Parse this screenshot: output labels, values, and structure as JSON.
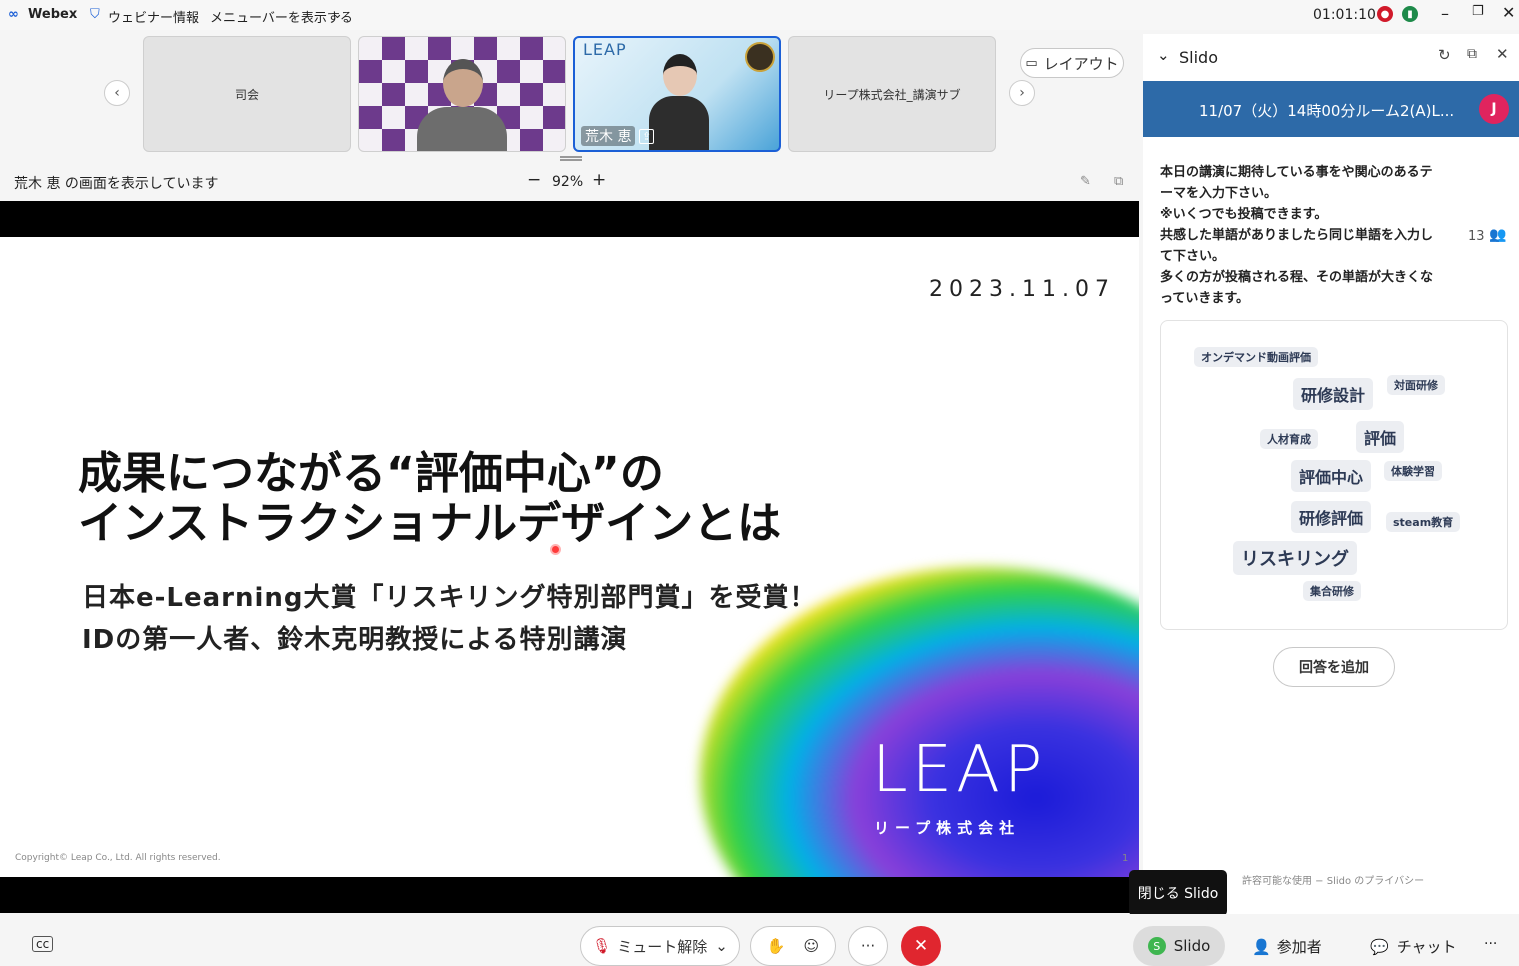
{
  "menubar": {
    "app_name": "Webex",
    "webinar_info": "ウェビナー情報",
    "show_menu": "メニューバーを表示する",
    "timer": "01:01:10"
  },
  "thumbnails": {
    "host_label": "司会",
    "speaker_name": "荒木 恵",
    "sub_label": "リープ株式会社_講演サブ",
    "layout_button": "レイアウト",
    "speaker_logo_text": "LEAP"
  },
  "share_bar": {
    "status": "荒木 恵 の画面を表示しています",
    "zoom": "92%",
    "zoom_out": "−",
    "zoom_in": "+"
  },
  "slide": {
    "date": "2023.11.07",
    "title_line1": "成果につながる“評価中心”の",
    "title_line2": "インストラクショナルデザインとは",
    "sub_line1": "日本e-Learning大賞「リスキリング特別部門賞」を受賞！",
    "sub_line2": "IDの第一人者、鈴木克明教授による特別講演",
    "logo": "LEAP",
    "company": "リープ株式会社",
    "copyright": "Copyright© Leap Co., Ltd. All rights reserved.",
    "page": "1"
  },
  "slido": {
    "title": "Slido",
    "room": "11/07（火）14時00分ルーム2(A)L...",
    "avatar": "J",
    "question_lines": [
      "本日の講演に期待している事をや関心のあるテ",
      "ーマを入力下さい。",
      "※いくつでも投稿できます。",
      "共感した単語がありましたら同じ単語を入力し",
      "て下さい。",
      "多くの方が投稿される程、その単語が大きくな",
      "っていきます。"
    ],
    "participants": "13",
    "words": [
      "オンデマンド動画評価",
      "研修設計",
      "対面研修",
      "人材育成",
      "評価",
      "評価中心",
      "体験学習",
      "研修評価",
      "steam教育",
      "リスキリング",
      "集合研修"
    ],
    "add_answer": "回答を追加",
    "footer": "許容可能な使用 − Slido のプライバシー",
    "close_tooltip": "閉じる Slido"
  },
  "bottom": {
    "mute": "ミュート解除",
    "more": "···",
    "slido": "Slido",
    "participants": "参加者",
    "chat": "チャット",
    "overflow": "···"
  },
  "colors": {
    "slido_header": "#2d6aa8",
    "end_button": "#e0262f",
    "avatar": "#e0245e"
  }
}
